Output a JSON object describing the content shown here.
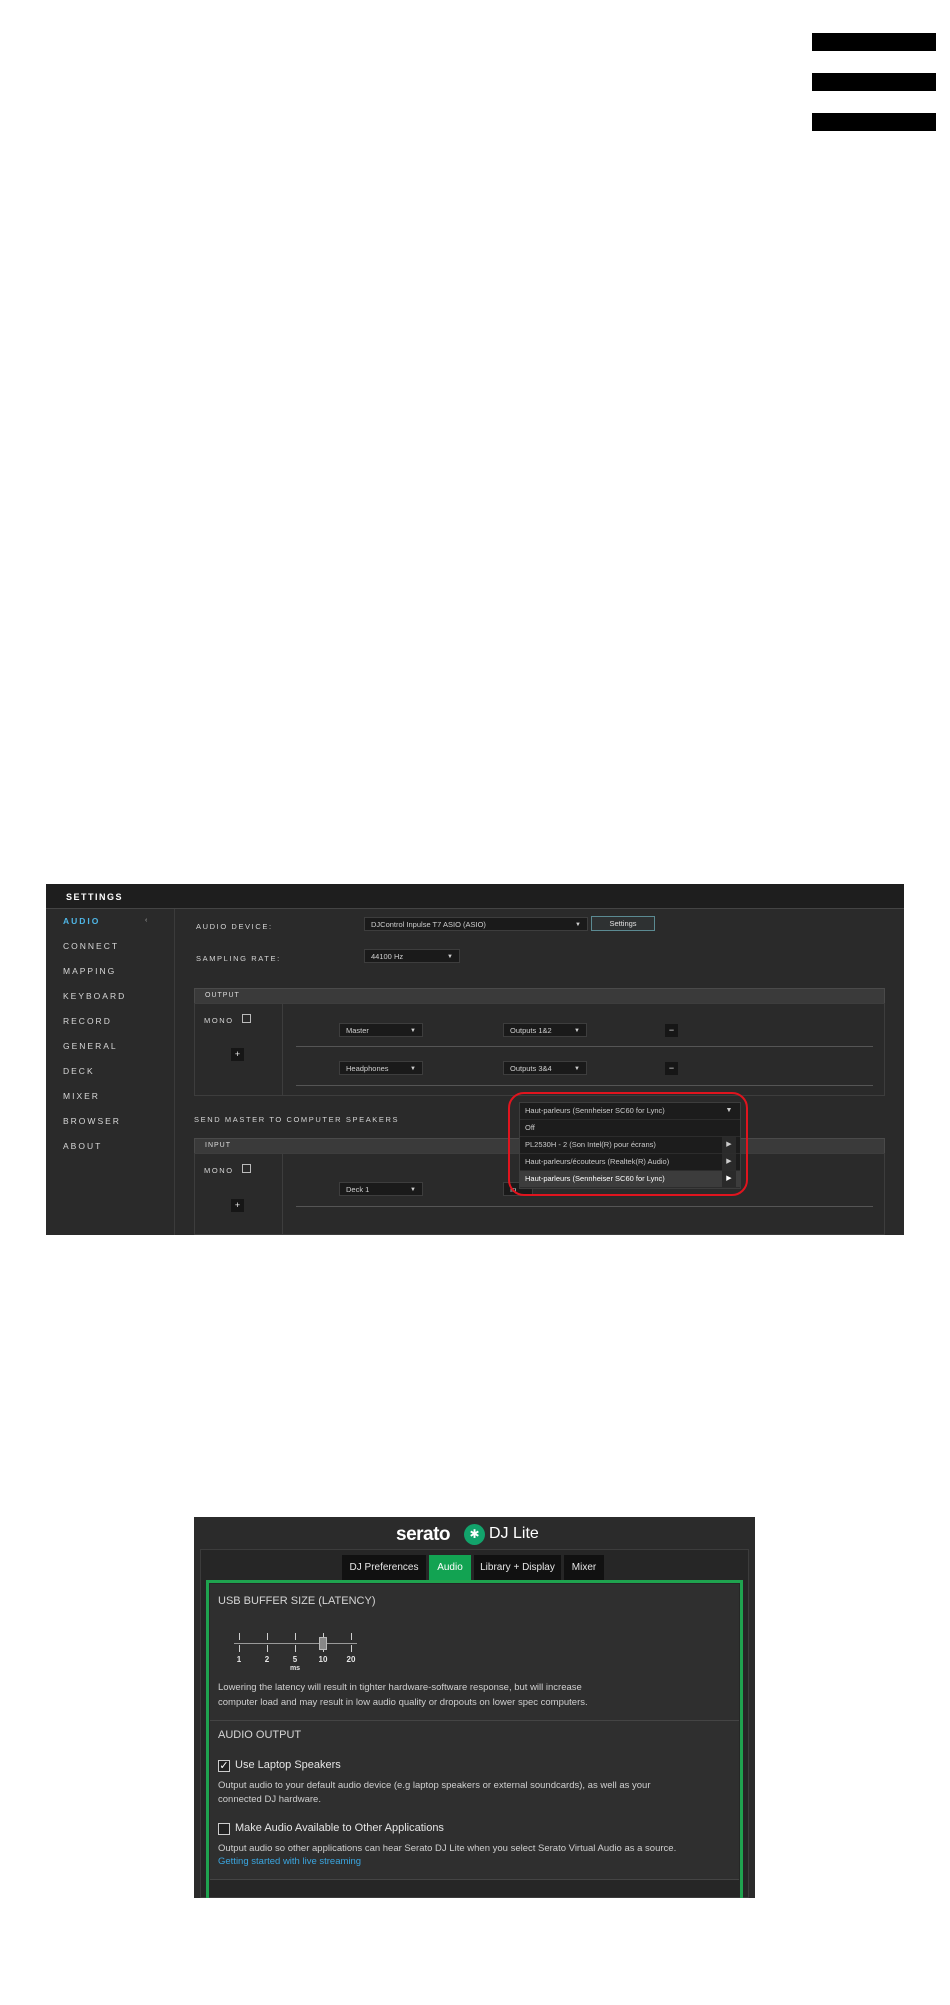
{
  "dj_pro": {
    "title": "SETTINGS",
    "sidebar": [
      "AUDIO",
      "CONNECT",
      "MAPPING",
      "KEYBOARD",
      "RECORD",
      "GENERAL",
      "DECK",
      "MIXER",
      "BROWSER",
      "ABOUT"
    ],
    "active_item": "AUDIO",
    "audio_device_label": "AUDIO DEVICE:",
    "audio_device_value": "DJControl Inpulse T7 ASIO (ASIO)",
    "settings_button": "Settings",
    "sampling_rate_label": "SAMPLING RATE:",
    "sampling_rate_value": "44100 Hz",
    "output_header": "OUTPUT",
    "mono_label": "MONO",
    "output_rows": [
      {
        "source": "Master",
        "dest": "Outputs 1&2"
      },
      {
        "source": "Headphones",
        "dest": "Outputs 3&4"
      }
    ],
    "send_master_label": "SEND MASTER TO COMPUTER SPEAKERS",
    "speakers_selected": "Haut-parleurs (Sennheiser SC60 for Lync)",
    "speakers_options": [
      "Off",
      "PL2530H - 2 (Son Intel(R) pour écrans)",
      "Haut-parleurs/écouteurs (Realtek(R) Audio)",
      "Haut-parleurs (Sennheiser SC60 for Lync)"
    ],
    "input_header": "INPUT",
    "input_row_source": "Deck 1",
    "input_row_dest_partial": "In"
  },
  "dj_lite": {
    "brand": "serato",
    "product": "DJ Lite",
    "tabs": [
      "DJ Preferences",
      "Audio",
      "Library + Display",
      "Mixer"
    ],
    "active_tab": "Audio",
    "usb_buffer_title": "USB BUFFER SIZE (LATENCY)",
    "latency_ticks": [
      "1",
      "2",
      "5",
      "10",
      "20"
    ],
    "latency_unit": "ms",
    "latency_selected": "10",
    "latency_note_line1": "Lowering the latency will result in tighter hardware-software response, but will increase",
    "latency_note_line2": "computer load and may result in low audio quality or dropouts on lower spec computers.",
    "audio_output_title": "AUDIO OUTPUT",
    "use_laptop_label": "Use Laptop Speakers",
    "use_laptop_checked": true,
    "use_laptop_desc_line1": "Output audio to your default audio device (e.g laptop speakers or external soundcards), as well as your",
    "use_laptop_desc_line2": "connected DJ hardware.",
    "make_available_label": "Make Audio Available to Other Applications",
    "make_available_checked": false,
    "make_available_desc": "Output audio so other applications can hear Serato DJ Lite when you select Serato Virtual Audio as a source.",
    "streaming_link": "Getting started with live streaming"
  },
  "icons": [
    "menu-icon",
    "caret-down-icon",
    "plus-icon",
    "minus-icon",
    "submenu-arrow-icon",
    "checkmark-icon",
    "serato-logo-icon"
  ]
}
